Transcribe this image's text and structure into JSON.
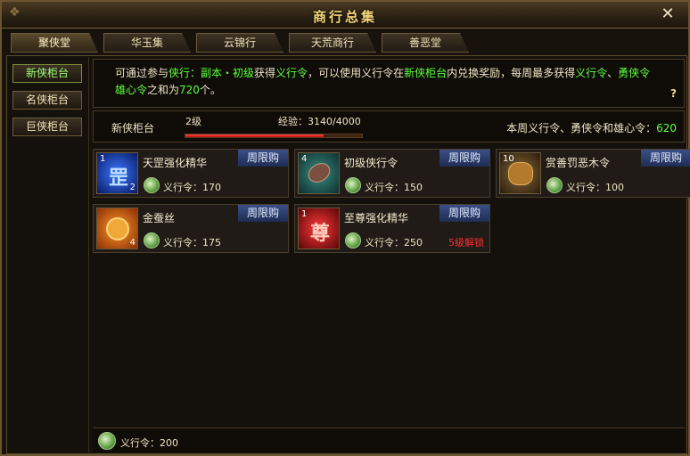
{
  "window": {
    "title": "商行总集",
    "close_label": "✕"
  },
  "tabs": [
    {
      "label": "聚侠堂"
    },
    {
      "label": "华玉集"
    },
    {
      "label": "云锦行"
    },
    {
      "label": "天荒商行"
    },
    {
      "label": "善恶堂"
    }
  ],
  "sidebar": {
    "items": [
      {
        "label": "新侠柜台",
        "active": true
      },
      {
        "label": "名侠柜台"
      },
      {
        "label": "巨侠柜台"
      }
    ]
  },
  "info": {
    "p1": "可通过参与",
    "p2": "侠行：副本・初级",
    "p3": "获得",
    "p4": "义行令",
    "p5": "，可以使用义行令在",
    "p6": "新侠柜台",
    "p7": "内兑换奖励，每周最多获得",
    "p8": "义行令",
    "p9": "、",
    "p10": "勇侠令",
    "p11": "、",
    "p12": "雄心令",
    "p13": "之和为",
    "p14": "720",
    "p15": "个。",
    "help_label": "?"
  },
  "level": {
    "counter_name": "新侠柜台",
    "level_label": "2级",
    "exp_label": "经验：3140/4000",
    "exp_fraction": 0.785,
    "weekly_label": "本周义行令、勇侠令和雄心令：",
    "weekly_value": "620"
  },
  "items": [
    {
      "name": "天罡强化精华",
      "tag": "周限购",
      "stack_top": "1",
      "stack_bottom": "2",
      "price": "义行令：170",
      "lock": "",
      "icon": "blue-rune-icon"
    },
    {
      "name": "初级侠行令",
      "tag": "周限购",
      "stack_top": "4",
      "stack_bottom": "",
      "price": "义行令：150",
      "lock": "",
      "icon": "stone-token-icon"
    },
    {
      "name": "赏善罚恶木令",
      "tag": "周限购",
      "stack_top": "10",
      "stack_bottom": "",
      "price": "义行令：100",
      "lock": "",
      "icon": "wood-token-icon"
    },
    {
      "name": "金蚕丝",
      "tag": "周限购",
      "stack_top": "",
      "stack_bottom": "4",
      "price": "义行令：175",
      "lock": "",
      "icon": "silk-spool-icon"
    },
    {
      "name": "至尊强化精华",
      "tag": "周限购",
      "stack_top": "1",
      "stack_bottom": "",
      "price": "义行令：250",
      "lock": "5级解锁",
      "icon": "red-rune-icon"
    }
  ],
  "footer": {
    "balance": "义行令：200"
  }
}
